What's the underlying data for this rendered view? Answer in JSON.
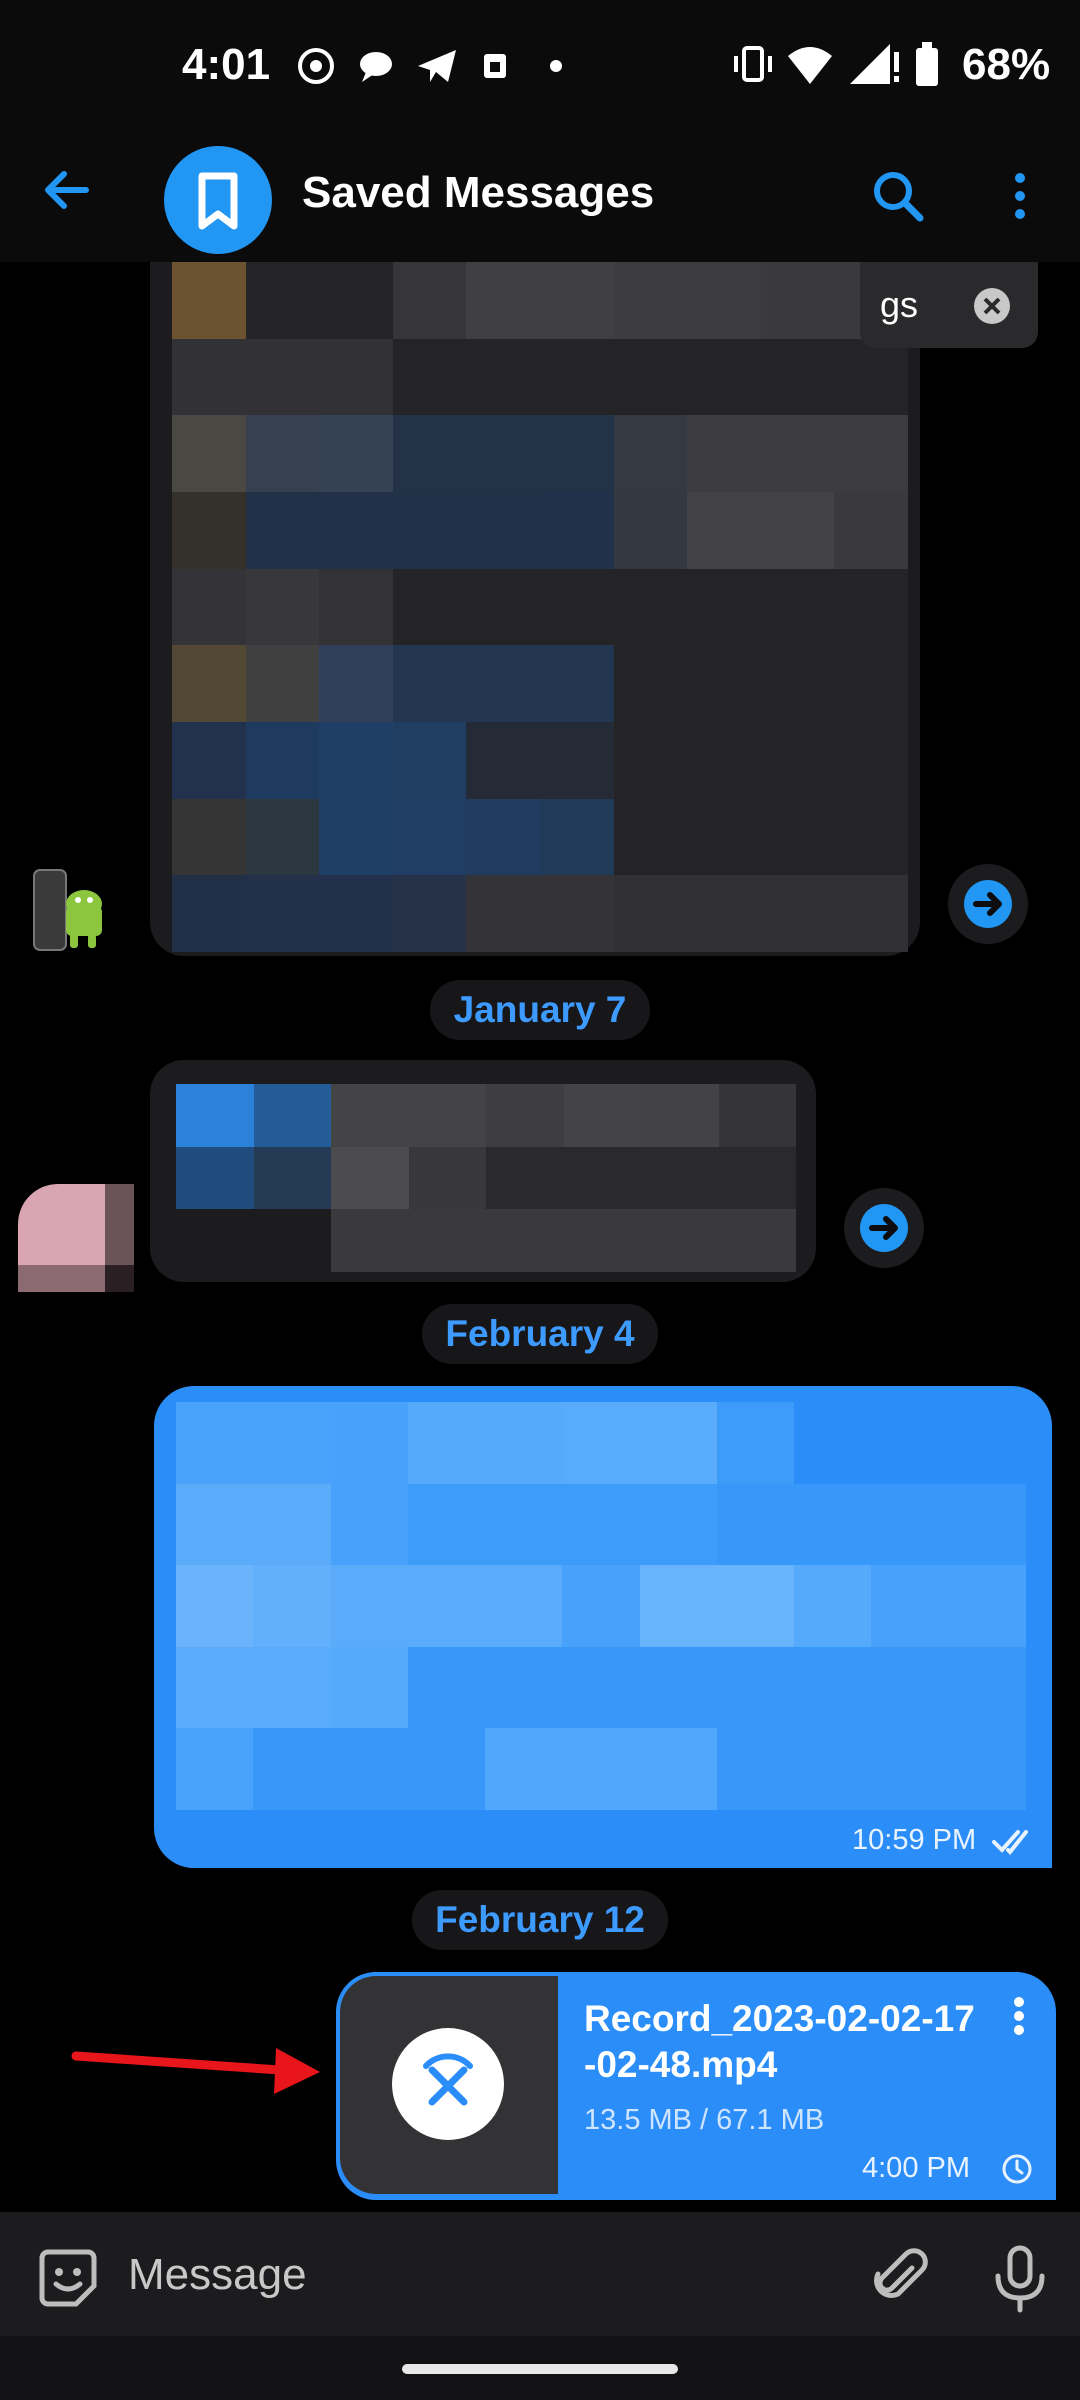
{
  "status_bar": {
    "time": "4:01",
    "battery": "68%"
  },
  "header": {
    "title": "Saved Messages"
  },
  "toast": {
    "text": "gs"
  },
  "dates": [
    "January 7",
    "February 4",
    "February 12"
  ],
  "blue_message": {
    "time": "10:59 PM"
  },
  "file_message": {
    "name_line1": "Record_2023-02-02-17",
    "name_line2": "-02-48.mp4",
    "progress": "13.5 MB / 67.1 MB",
    "time": "4:00 PM"
  },
  "input": {
    "placeholder": "Message"
  },
  "colors": {
    "accent": "#2196f3",
    "bubble_out": "#2b8ef8",
    "bubble_in": "#1c1c1f",
    "date_text": "#3d9aff",
    "annotation": "#e8161b"
  }
}
